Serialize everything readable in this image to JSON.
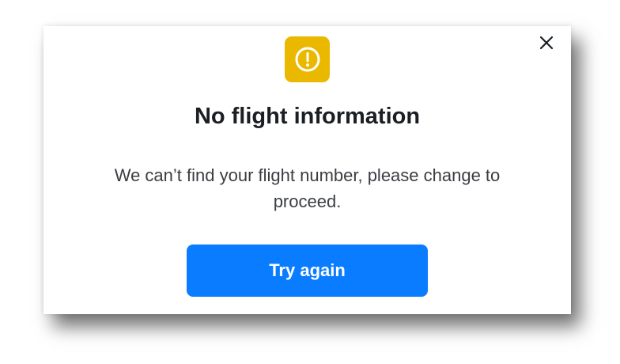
{
  "dialog": {
    "title": "No flight information",
    "message": "We can’t find your flight number, please change to proceed.",
    "primary_button_label": "Try again",
    "icons": {
      "alert": "exclamation-circle-icon",
      "close": "close-icon"
    },
    "colors": {
      "alert_badge": "#EBB800",
      "primary_button": "#0A7CFF",
      "title_text": "#1B1F24",
      "message_text": "#3A3D42"
    }
  }
}
